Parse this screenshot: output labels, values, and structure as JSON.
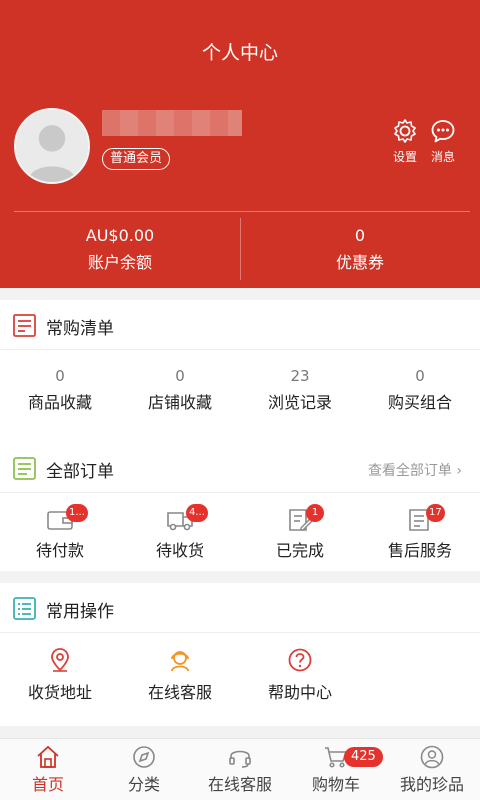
{
  "header": {
    "title": "个人中心",
    "member_badge": "普通会员",
    "settings_label": "设置",
    "messages_label": "消息",
    "balance_value": "AU$0.00",
    "balance_label": "账户余额",
    "coupon_value": "0",
    "coupon_label": "优惠券"
  },
  "favorites": {
    "title": "常购清单",
    "items": [
      {
        "count": "0",
        "label": "商品收藏"
      },
      {
        "count": "0",
        "label": "店铺收藏"
      },
      {
        "count": "23",
        "label": "浏览记录"
      },
      {
        "count": "0",
        "label": "购买组合"
      }
    ]
  },
  "orders": {
    "title": "全部订单",
    "view_all": "查看全部订单 ›",
    "items": [
      {
        "label": "待付款",
        "badge": "1..."
      },
      {
        "label": "待收货",
        "badge": "4..."
      },
      {
        "label": "已完成",
        "badge": "1"
      },
      {
        "label": "售后服务",
        "badge": "17"
      }
    ]
  },
  "operations": {
    "title": "常用操作",
    "items": [
      {
        "label": "收货地址"
      },
      {
        "label": "在线客服"
      },
      {
        "label": "帮助中心"
      }
    ]
  },
  "tabbar": {
    "items": [
      {
        "label": "首页"
      },
      {
        "label": "分类"
      },
      {
        "label": "在线客服"
      },
      {
        "label": "购物车",
        "badge": "425"
      },
      {
        "label": "我的珍品"
      }
    ]
  },
  "colors": {
    "brand": "#cf3325",
    "badge": "#e5322d"
  }
}
